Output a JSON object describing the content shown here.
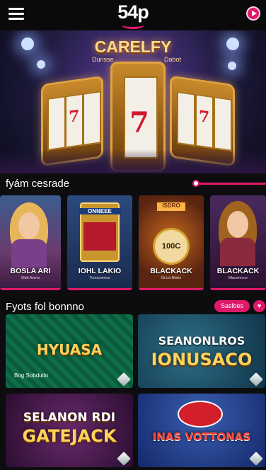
{
  "header": {
    "logo_text": "54p",
    "menu_icon": "hamburger-menu-icon",
    "play_icon": "play-icon"
  },
  "hero": {
    "title": "CARELFY",
    "sub_left": "Dunsse",
    "sub_right": "Dabot",
    "reel_symbol": "7"
  },
  "section1": {
    "title": "fyám cesrade"
  },
  "games": [
    {
      "name": "BOSLA ARI",
      "sub": "Slidt Arene"
    },
    {
      "name": "IOHL LAKIO",
      "sub": "Tcoosoeess",
      "sign": "ONNEEE"
    },
    {
      "name": "BLACKACK",
      "sub": "Grsnt Blaks",
      "sign": "ISDRO",
      "chip": "100C"
    },
    {
      "name": "BLACKACK",
      "sub": "Blacsrecce"
    }
  ],
  "section2": {
    "title": "Fyots fol bonnno",
    "filter_label": "Saslbes",
    "heart_icon": "heart-icon"
  },
  "tiles": [
    {
      "title": "HYUASA",
      "caption": "Bog Sobdutlo"
    },
    {
      "title_line1": "SEANONLROS",
      "title_line2": "IONUSACO"
    },
    {
      "title_line1": "SELANON RDI",
      "title_line2": "GATEJACK"
    },
    {
      "title": "INAS VOTTONAS"
    }
  ],
  "colors": {
    "accent": "#e0196a",
    "background": "#0d0d10",
    "gold": "#ffd25a"
  }
}
